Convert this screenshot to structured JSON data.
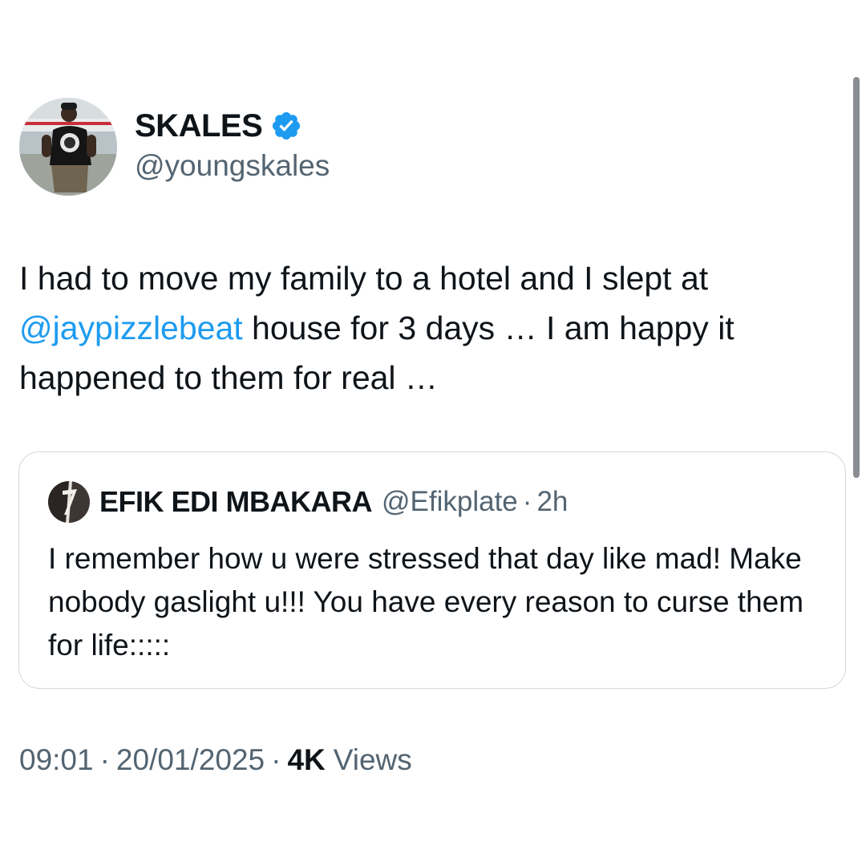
{
  "tweet": {
    "author": {
      "display_name": "SKALES",
      "handle": "@youngskales",
      "verified": true,
      "avatar_icon": "profile-photo"
    },
    "text_parts": [
      "I had to move my family to a hotel and I slept at ",
      "@jaypizzlebeat",
      " house for 3 days … I am happy it happened to them for real …"
    ],
    "time": "09:01",
    "date": "20/01/2025",
    "separator": "·",
    "views_count": "4K",
    "views_label": "Views"
  },
  "quote": {
    "display_name": "EFIK EDI MBAKARA",
    "handle": "@Efikplate",
    "time_ago": "2h",
    "separator": "·",
    "text": "I remember how u were stressed that day like mad! Make nobody gaslight u!!!  You have every reason to curse them for life:::::",
    "avatar_icon": "profile-photo"
  },
  "colors": {
    "mention": "#1d9bf0",
    "verified_badge": "#1d9bf0",
    "secondary_text": "#536471",
    "primary_text": "#0f1419",
    "card_border": "#cfd9de"
  }
}
